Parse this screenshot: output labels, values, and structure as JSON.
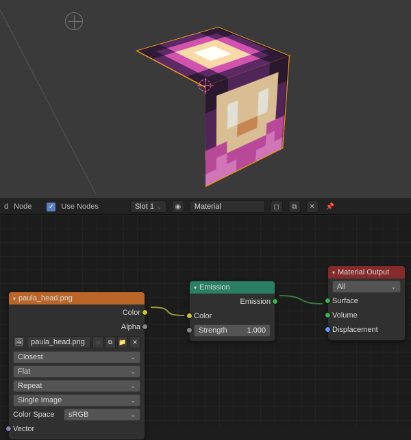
{
  "header": {
    "d_label": "d",
    "node_label": "Node",
    "use_nodes_label": "Use Nodes",
    "slot_label": "Slot 1",
    "material_label": "Material"
  },
  "nodes": {
    "image_tex": {
      "title": "paula_head.png",
      "outputs": {
        "color": "Color",
        "alpha": "Alpha"
      },
      "file_name": "paula_head.png",
      "interp": "Closest",
      "projection": "Flat",
      "extension": "Repeat",
      "source": "Single Image",
      "color_space_label": "Color Space",
      "color_space_value": "sRGB",
      "vector_in": "Vector"
    },
    "emission": {
      "title": "Emission",
      "out": "Emission",
      "color_in": "Color",
      "strength_label": "Strength",
      "strength_value": "1.000"
    },
    "material_output": {
      "title": "Material Output",
      "target": "All",
      "surface": "Surface",
      "volume": "Volume",
      "displacement": "Displacement"
    }
  },
  "cube_palette": {
    "dp": "#2e1a33",
    "mp": "#57285f",
    "pk": "#c84fa6",
    "lp": "#e27fc8",
    "cr": "#eccfa0",
    "wt": "#f5f3e9",
    "or": "#d7915a"
  },
  "cube_faces": {
    "top": [
      "dp",
      "dp",
      "mp",
      "mp",
      "mp",
      "mp",
      "dp",
      "dp",
      "dp",
      "mp",
      "pk",
      "pk",
      "pk",
      "pk",
      "mp",
      "dp",
      "mp",
      "pk",
      "cr",
      "cr",
      "cr",
      "cr",
      "pk",
      "mp",
      "mp",
      "pk",
      "cr",
      "wt",
      "wt",
      "cr",
      "pk",
      "mp",
      "mp",
      "pk",
      "cr",
      "wt",
      "wt",
      "cr",
      "pk",
      "mp",
      "mp",
      "pk",
      "cr",
      "cr",
      "cr",
      "cr",
      "pk",
      "mp",
      "dp",
      "mp",
      "pk",
      "pk",
      "pk",
      "pk",
      "mp",
      "dp",
      "dp",
      "dp",
      "mp",
      "mp",
      "mp",
      "mp",
      "dp",
      "dp"
    ],
    "front": [
      "dp",
      "dp",
      "mp",
      "mp",
      "mp",
      "mp",
      "dp",
      "dp",
      "dp",
      "cr",
      "cr",
      "cr",
      "cr",
      "cr",
      "cr",
      "dp",
      "mp",
      "cr",
      "wt",
      "cr",
      "cr",
      "wt",
      "cr",
      "mp",
      "mp",
      "cr",
      "wt",
      "cr",
      "cr",
      "wt",
      "cr",
      "mp",
      "mp",
      "cr",
      "cr",
      "or",
      "or",
      "cr",
      "cr",
      "mp",
      "pk",
      "pk",
      "cr",
      "cr",
      "cr",
      "cr",
      "pk",
      "pk",
      "pk",
      "lp",
      "pk",
      "pk",
      "pk",
      "pk",
      "lp",
      "pk",
      "lp",
      "lp",
      "lp",
      "pk",
      "pk",
      "lp",
      "lp",
      "lp"
    ],
    "right": [
      "dp",
      "dp",
      "dp",
      "dp",
      "mp",
      "mp",
      "dp",
      "dp",
      "dp",
      "mp",
      "mp",
      "cr",
      "cr",
      "cr",
      "mp",
      "dp",
      "mp",
      "mp",
      "cr",
      "wt",
      "cr",
      "cr",
      "cr",
      "mp",
      "mp",
      "cr",
      "wt",
      "cr",
      "cr",
      "cr",
      "cr",
      "mp",
      "mp",
      "cr",
      "cr",
      "or",
      "cr",
      "cr",
      "cr",
      "mp",
      "pk",
      "pk",
      "cr",
      "cr",
      "cr",
      "pk",
      "pk",
      "pk",
      "pk",
      "lp",
      "pk",
      "pk",
      "pk",
      "lp",
      "pk",
      "pk",
      "lp",
      "lp",
      "lp",
      "pk",
      "lp",
      "lp",
      "lp",
      "pk"
    ]
  }
}
